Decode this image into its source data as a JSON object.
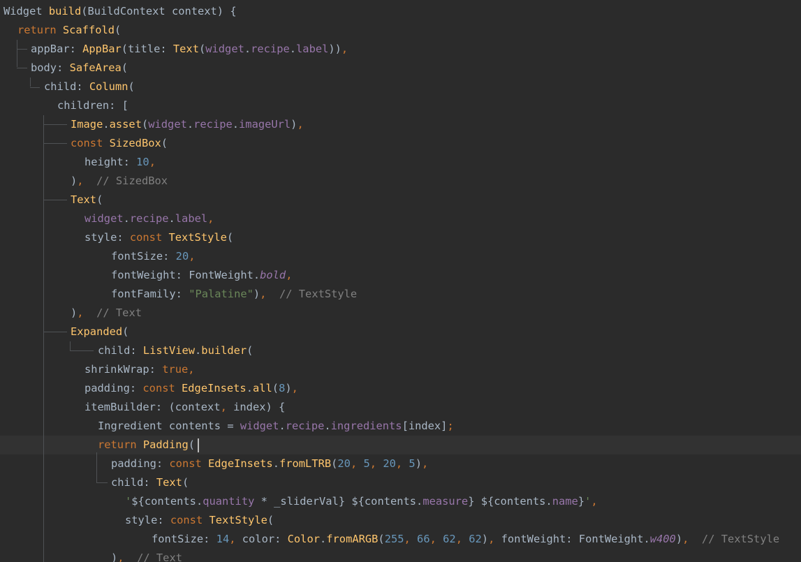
{
  "editor": {
    "language": "dart",
    "colors": {
      "background": "#2b2b2b",
      "current_line": "#323232",
      "default_text": "#a9b7c6",
      "keyword": "#cc7832",
      "function": "#ffc66d",
      "property": "#9876aa",
      "number": "#6897bb",
      "string": "#6a8759",
      "comment": "#808080"
    },
    "lines": [
      {
        "segments": [
          {
            "t": "Widget "
          },
          {
            "t": "build",
            "c": "fn"
          },
          {
            "t": "(BuildContext context) {"
          }
        ]
      },
      {
        "segments": [
          {
            "t": "return ",
            "c": "kw"
          },
          {
            "t": "Scaffold",
            "c": "fn"
          },
          {
            "t": "("
          }
        ]
      },
      {
        "segments": [
          {
            "t": "appBar: "
          },
          {
            "t": "AppBar",
            "c": "fn"
          },
          {
            "t": "(title: "
          },
          {
            "t": "Text",
            "c": "fn"
          },
          {
            "t": "("
          },
          {
            "t": "widget",
            "c": "prop"
          },
          {
            "t": "."
          },
          {
            "t": "recipe",
            "c": "prop"
          },
          {
            "t": "."
          },
          {
            "t": "label",
            "c": "prop"
          },
          {
            "t": "))"
          },
          {
            "t": ",",
            "c": "kw"
          }
        ]
      },
      {
        "segments": [
          {
            "t": "body: "
          },
          {
            "t": "SafeArea",
            "c": "fn"
          },
          {
            "t": "("
          }
        ]
      },
      {
        "segments": [
          {
            "t": "child: "
          },
          {
            "t": "Column",
            "c": "fn"
          },
          {
            "t": "("
          }
        ]
      },
      {
        "segments": [
          {
            "t": "children: ["
          }
        ]
      },
      {
        "segments": [
          {
            "t": "Image",
            "c": "fn"
          },
          {
            "t": "."
          },
          {
            "t": "asset",
            "c": "fn"
          },
          {
            "t": "("
          },
          {
            "t": "widget",
            "c": "prop"
          },
          {
            "t": "."
          },
          {
            "t": "recipe",
            "c": "prop"
          },
          {
            "t": "."
          },
          {
            "t": "imageUrl",
            "c": "prop"
          },
          {
            "t": ")"
          },
          {
            "t": ",",
            "c": "kw"
          }
        ]
      },
      {
        "segments": [
          {
            "t": "const ",
            "c": "kw"
          },
          {
            "t": "SizedBox",
            "c": "fn"
          },
          {
            "t": "("
          }
        ]
      },
      {
        "segments": [
          {
            "t": "height: "
          },
          {
            "t": "10",
            "c": "num"
          },
          {
            "t": ",",
            "c": "kw"
          }
        ]
      },
      {
        "segments": [
          {
            "t": ")"
          },
          {
            "t": ",",
            "c": "kw"
          },
          {
            "t": "  "
          },
          {
            "t": "// SizedBox",
            "c": "cmt"
          }
        ]
      },
      {
        "segments": [
          {
            "t": "Text",
            "c": "fn"
          },
          {
            "t": "("
          }
        ]
      },
      {
        "segments": [
          {
            "t": "widget",
            "c": "prop"
          },
          {
            "t": "."
          },
          {
            "t": "recipe",
            "c": "prop"
          },
          {
            "t": "."
          },
          {
            "t": "label",
            "c": "prop"
          },
          {
            "t": ",",
            "c": "kw"
          }
        ]
      },
      {
        "segments": [
          {
            "t": "style: "
          },
          {
            "t": "const ",
            "c": "kw"
          },
          {
            "t": "TextStyle",
            "c": "fn"
          },
          {
            "t": "("
          }
        ]
      },
      {
        "segments": [
          {
            "t": "fontSize: "
          },
          {
            "t": "20",
            "c": "num"
          },
          {
            "t": ",",
            "c": "kw"
          }
        ]
      },
      {
        "segments": [
          {
            "t": "fontWeight: FontWeight."
          },
          {
            "t": "bold",
            "c": "prop it"
          },
          {
            "t": ",",
            "c": "kw"
          }
        ]
      },
      {
        "segments": [
          {
            "t": "fontFamily: "
          },
          {
            "t": "\"Palatine\"",
            "c": "str"
          },
          {
            "t": ")"
          },
          {
            "t": ",",
            "c": "kw"
          },
          {
            "t": "  "
          },
          {
            "t": "// TextStyle",
            "c": "cmt"
          }
        ]
      },
      {
        "segments": [
          {
            "t": ")"
          },
          {
            "t": ",",
            "c": "kw"
          },
          {
            "t": "  "
          },
          {
            "t": "// Text",
            "c": "cmt"
          }
        ]
      },
      {
        "segments": [
          {
            "t": "Expanded",
            "c": "fn"
          },
          {
            "t": "("
          }
        ]
      },
      {
        "segments": [
          {
            "t": "child: "
          },
          {
            "t": "ListView",
            "c": "fn"
          },
          {
            "t": "."
          },
          {
            "t": "builder",
            "c": "fn"
          },
          {
            "t": "("
          }
        ]
      },
      {
        "segments": [
          {
            "t": "shrinkWrap: "
          },
          {
            "t": "true",
            "c": "kw"
          },
          {
            "t": ",",
            "c": "kw"
          }
        ]
      },
      {
        "segments": [
          {
            "t": "padding: "
          },
          {
            "t": "const ",
            "c": "kw"
          },
          {
            "t": "EdgeInsets",
            "c": "fn"
          },
          {
            "t": "."
          },
          {
            "t": "all",
            "c": "fn"
          },
          {
            "t": "("
          },
          {
            "t": "8",
            "c": "num"
          },
          {
            "t": ")"
          },
          {
            "t": ",",
            "c": "kw"
          }
        ]
      },
      {
        "segments": [
          {
            "t": "itemBuilder: (context"
          },
          {
            "t": ",",
            "c": "kw"
          },
          {
            "t": " index) {"
          }
        ]
      },
      {
        "segments": [
          {
            "t": "Ingredient contents = "
          },
          {
            "t": "widget",
            "c": "prop"
          },
          {
            "t": "."
          },
          {
            "t": "recipe",
            "c": "prop"
          },
          {
            "t": "."
          },
          {
            "t": "ingredients",
            "c": "prop"
          },
          {
            "t": "[index]"
          },
          {
            "t": ";",
            "c": "kw"
          }
        ]
      },
      {
        "segments": [
          {
            "t": "return ",
            "c": "kw"
          },
          {
            "t": "Padding",
            "c": "fn"
          },
          {
            "t": "("
          }
        ]
      },
      {
        "segments": [
          {
            "t": "padding: "
          },
          {
            "t": "const ",
            "c": "kw"
          },
          {
            "t": "EdgeInsets",
            "c": "fn"
          },
          {
            "t": "."
          },
          {
            "t": "fromLTRB",
            "c": "fn"
          },
          {
            "t": "("
          },
          {
            "t": "20",
            "c": "num"
          },
          {
            "t": ", ",
            "c": "kw"
          },
          {
            "t": "5",
            "c": "num"
          },
          {
            "t": ", ",
            "c": "kw"
          },
          {
            "t": "20",
            "c": "num"
          },
          {
            "t": ", ",
            "c": "kw"
          },
          {
            "t": "5",
            "c": "num"
          },
          {
            "t": ")"
          },
          {
            "t": ",",
            "c": "kw"
          }
        ]
      },
      {
        "segments": [
          {
            "t": "child: "
          },
          {
            "t": "Text",
            "c": "fn"
          },
          {
            "t": "("
          }
        ]
      },
      {
        "segments": [
          {
            "t": "'",
            "c": "str"
          },
          {
            "t": "${contents."
          },
          {
            "t": "quantity",
            "c": "prop"
          },
          {
            "t": " * _sliderVal}"
          },
          {
            "t": " ",
            "c": "str"
          },
          {
            "t": "${contents."
          },
          {
            "t": "measure",
            "c": "prop"
          },
          {
            "t": "}"
          },
          {
            "t": " ",
            "c": "str"
          },
          {
            "t": "${contents."
          },
          {
            "t": "name",
            "c": "prop"
          },
          {
            "t": "}"
          },
          {
            "t": "'",
            "c": "str"
          },
          {
            "t": ",",
            "c": "kw"
          }
        ]
      },
      {
        "segments": [
          {
            "t": "style: "
          },
          {
            "t": "const ",
            "c": "kw"
          },
          {
            "t": "TextStyle",
            "c": "fn"
          },
          {
            "t": "("
          }
        ]
      },
      {
        "segments": [
          {
            "t": "fontSize: "
          },
          {
            "t": "14",
            "c": "num"
          },
          {
            "t": ", ",
            "c": "kw"
          },
          {
            "t": "color: "
          },
          {
            "t": "Color",
            "c": "fn"
          },
          {
            "t": "."
          },
          {
            "t": "fromARGB",
            "c": "fn"
          },
          {
            "t": "("
          },
          {
            "t": "255",
            "c": "num"
          },
          {
            "t": ", ",
            "c": "kw"
          },
          {
            "t": "66",
            "c": "num"
          },
          {
            "t": ", ",
            "c": "kw"
          },
          {
            "t": "62",
            "c": "num"
          },
          {
            "t": ", ",
            "c": "kw"
          },
          {
            "t": "62",
            "c": "num"
          },
          {
            "t": ")"
          },
          {
            "t": ", ",
            "c": "kw"
          },
          {
            "t": "fontWeight: FontWeight."
          },
          {
            "t": "w400",
            "c": "prop it"
          },
          {
            "t": ")"
          },
          {
            "t": ",",
            "c": "kw"
          },
          {
            "t": "  "
          },
          {
            "t": "// TextStyle",
            "c": "cmt"
          }
        ]
      },
      {
        "segments": [
          {
            "t": ")"
          },
          {
            "t": ",",
            "c": "kw"
          },
          {
            "t": "  "
          },
          {
            "t": "// Text",
            "c": "cmt"
          }
        ]
      }
    ]
  }
}
